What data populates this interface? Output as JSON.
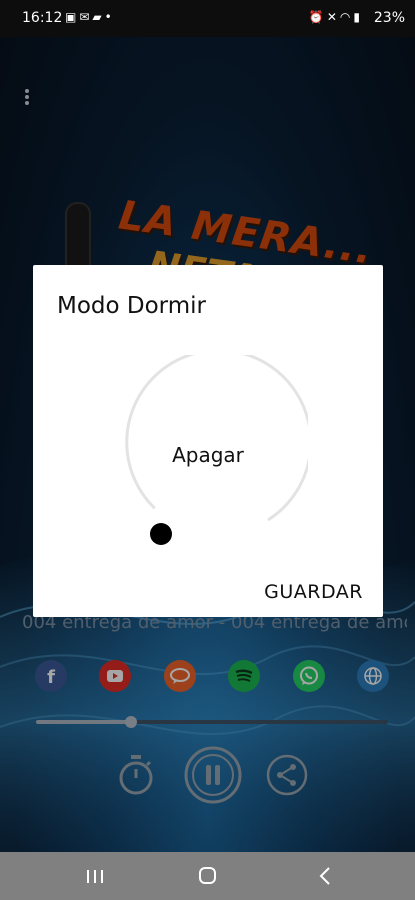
{
  "status_bar": {
    "time": "16:12",
    "battery": "23%",
    "left_icons": [
      "image-icon",
      "mail-icon",
      "bag-icon",
      "dot-icon"
    ],
    "right_icons": [
      "alarm-icon",
      "mute-icon",
      "wifi-icon",
      "signal-icon"
    ]
  },
  "app": {
    "logo_text_line1": "LA MERA...",
    "logo_text_line2": "NETA",
    "now_playing": "004 entrega de amor - 004 entrega de amor",
    "socials": [
      {
        "name": "facebook",
        "glyph": "f",
        "color": "#3b5998"
      },
      {
        "name": "youtube",
        "glyph": "▶",
        "color": "#e52d27"
      },
      {
        "name": "chat",
        "glyph": "",
        "color": "#f0642a"
      },
      {
        "name": "spotify",
        "glyph": "",
        "color": "#1db954"
      },
      {
        "name": "whatsapp",
        "glyph": "",
        "color": "#25d366"
      },
      {
        "name": "web",
        "glyph": "",
        "color": "#2c7fbd"
      }
    ],
    "progress_fraction": 0.27
  },
  "dialog": {
    "title": "Modo Dormir",
    "dial_value": "Apagar",
    "save_label": "GUARDAR"
  }
}
